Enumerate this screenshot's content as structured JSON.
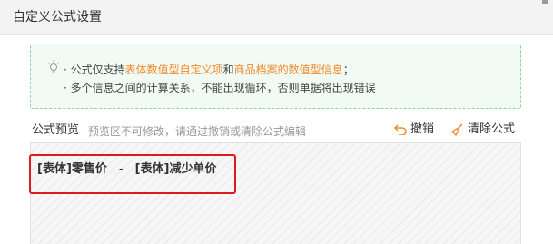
{
  "dialog": {
    "title": "自定义公式设置"
  },
  "tip": {
    "line1_prefix": "· 公式仅支持",
    "line1_hl1": "表体数值型自定义项",
    "line1_mid": "和",
    "line1_hl2": "商品档案的数值型信息",
    "line1_suffix": "；",
    "line2": "· 多个信息之间的计算关系，不能出现循环，否则单据将出现错误",
    "highlight_color": "#f08a2c"
  },
  "preview": {
    "label": "公式预览",
    "hint": "预览区不可修改，请通过撤销或清除公式编辑",
    "undo_label": "撤销",
    "clear_label": "清除公式",
    "formula": {
      "operand1": "[表体]零售价",
      "operator": "-",
      "operand2": "[表体]减少单价"
    },
    "highlight_border_color": "#e0191e"
  }
}
